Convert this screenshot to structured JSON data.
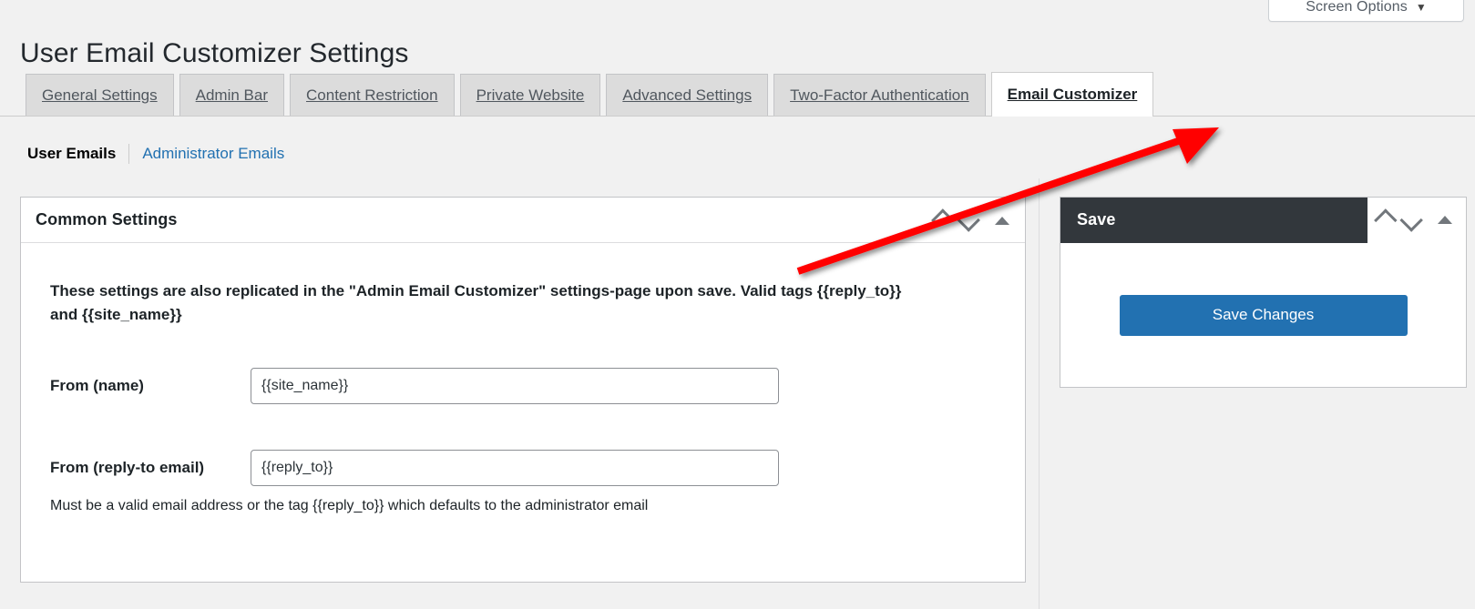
{
  "screen_options": {
    "label": "Screen Options",
    "caret": "▼"
  },
  "page": {
    "title": "User Email Customizer Settings"
  },
  "tabs": [
    {
      "label": "General Settings",
      "active": false
    },
    {
      "label": "Admin Bar",
      "active": false
    },
    {
      "label": "Content Restriction",
      "active": false
    },
    {
      "label": "Private Website",
      "active": false
    },
    {
      "label": "Advanced Settings",
      "active": false
    },
    {
      "label": "Two-Factor Authentication",
      "active": false
    },
    {
      "label": "Email Customizer",
      "active": true
    }
  ],
  "subnav": {
    "current": "User Emails",
    "link": "Administrator Emails"
  },
  "common_settings": {
    "title": "Common Settings",
    "description": "These settings are also replicated in the \"Admin Email Customizer\" settings-page upon save. Valid tags {{reply_to}} and {{site_name}}",
    "fields": [
      {
        "label": "From (name)",
        "value": "{{site_name}}",
        "placeholder": "",
        "hint": ""
      },
      {
        "label": "From (reply-to email)",
        "value": "{{reply_to}}",
        "placeholder": "",
        "hint": "Must be a valid email address or the tag {{reply_to}} which defaults to the administrator email"
      }
    ]
  },
  "save_box": {
    "title": "Save",
    "button_label": "Save Changes"
  },
  "icons": {
    "chevron_up": "chevron-up-icon",
    "chevron_down": "chevron-down-icon",
    "triangle_toggle": "triangle-up-toggle-icon"
  },
  "colors": {
    "page_background": "#f1f1f1",
    "accent_blue": "#2271b1",
    "link_blue": "#2271b1",
    "dark_header": "#32373c",
    "tab_inactive": "#dcdcdc",
    "annotation_red": "#ff0000"
  }
}
